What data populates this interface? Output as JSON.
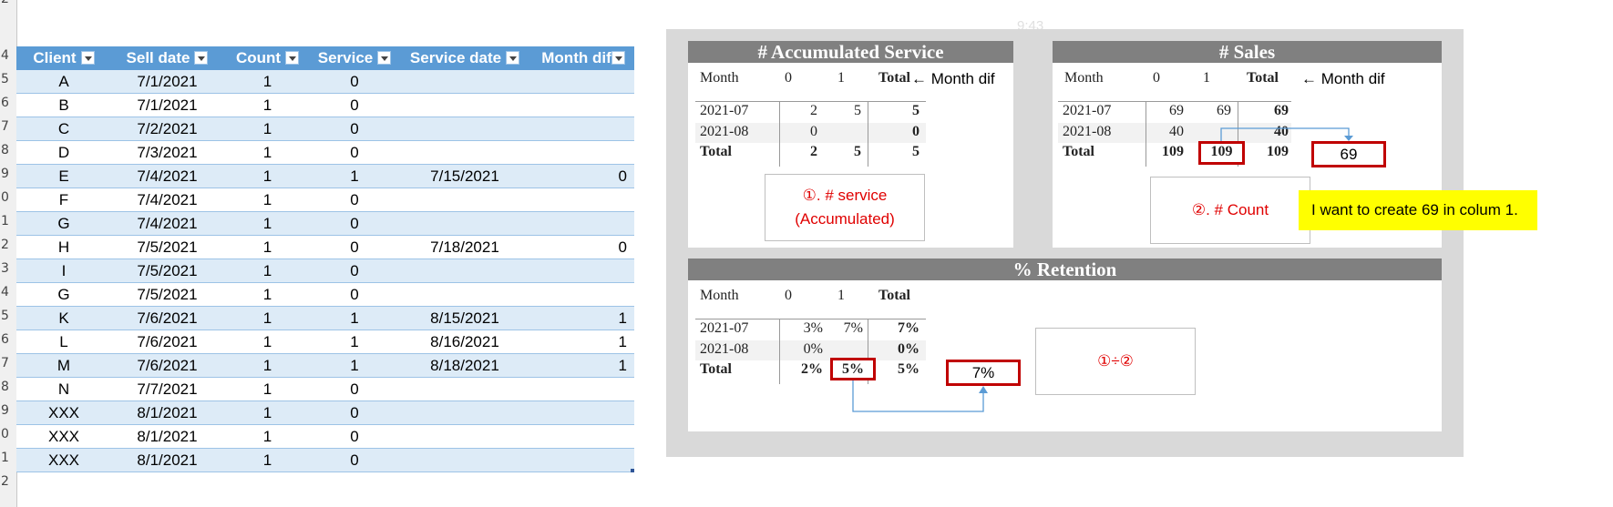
{
  "row_numbers": [
    "2",
    "4",
    "5",
    "6",
    "7",
    "8",
    "9",
    "0",
    "1",
    "2",
    "3",
    "4",
    "5",
    "6",
    "7",
    "8",
    "9",
    "0",
    "1",
    "2"
  ],
  "table": {
    "headers": [
      "Client",
      "Sell date",
      "Count",
      "Service",
      "Service date",
      "Month dif"
    ],
    "rows": [
      [
        "A",
        "7/1/2021",
        "1",
        "0",
        "",
        ""
      ],
      [
        "B",
        "7/1/2021",
        "1",
        "0",
        "",
        ""
      ],
      [
        "C",
        "7/2/2021",
        "1",
        "0",
        "",
        ""
      ],
      [
        "D",
        "7/3/2021",
        "1",
        "0",
        "",
        ""
      ],
      [
        "E",
        "7/4/2021",
        "1",
        "1",
        "7/15/2021",
        "0"
      ],
      [
        "F",
        "7/4/2021",
        "1",
        "0",
        "",
        ""
      ],
      [
        "G",
        "7/4/2021",
        "1",
        "0",
        "",
        ""
      ],
      [
        "H",
        "7/5/2021",
        "1",
        "0",
        "7/18/2021",
        "0"
      ],
      [
        "I",
        "7/5/2021",
        "1",
        "0",
        "",
        ""
      ],
      [
        "G",
        "7/5/2021",
        "1",
        "0",
        "",
        ""
      ],
      [
        "K",
        "7/6/2021",
        "1",
        "1",
        "8/15/2021",
        "1"
      ],
      [
        "L",
        "7/6/2021",
        "1",
        "1",
        "8/16/2021",
        "1"
      ],
      [
        "M",
        "7/6/2021",
        "1",
        "1",
        "8/18/2021",
        "1"
      ],
      [
        "N",
        "7/7/2021",
        "1",
        "0",
        "",
        ""
      ],
      [
        "XXX",
        "8/1/2021",
        "1",
        "0",
        "",
        ""
      ],
      [
        "XXX",
        "8/1/2021",
        "1",
        "0",
        "",
        ""
      ],
      [
        "XXX",
        "8/1/2021",
        "1",
        "0",
        "",
        ""
      ]
    ]
  },
  "faint_time": "9:43",
  "accumulated": {
    "title": "# Accumulated Service",
    "header": [
      "Month",
      "0",
      "1",
      "Total"
    ],
    "rows": [
      [
        "2021-07",
        "2",
        "5",
        "5"
      ],
      [
        "2021-08",
        "0",
        "",
        "0"
      ]
    ],
    "total": [
      "Total",
      "2",
      "5",
      "5"
    ],
    "month_dif_label": "← Month dif",
    "note_line1": "①. # service",
    "note_line2": "(Accumulated)"
  },
  "sales": {
    "title": "# Sales",
    "header": [
      "Month",
      "0",
      "1",
      "Total"
    ],
    "rows": [
      [
        "2021-07",
        "69",
        "69",
        "69"
      ],
      [
        "2021-08",
        "40",
        "",
        "40"
      ]
    ],
    "total": [
      "Total",
      "109",
      "109",
      "109"
    ],
    "month_dif_label": "← Month dif",
    "target_value": "69",
    "note": "②. # Count",
    "comment": "I want to create 69 in colum 1."
  },
  "retention": {
    "title": "% Retention",
    "header": [
      "Month",
      "0",
      "1",
      "Total"
    ],
    "rows": [
      [
        "2021-07",
        "3%",
        "7%",
        "7%"
      ],
      [
        "2021-08",
        "0%",
        "",
        "0%"
      ]
    ],
    "total": [
      "Total",
      "2%",
      "5%",
      "5%"
    ],
    "target_value": "7%",
    "note": "①÷②"
  },
  "colors": {
    "table_header": "#5b9bd5",
    "table_band": "#ddebf7",
    "panel_title": "#808080",
    "highlight_border": "#c00000",
    "note_text": "#e00000",
    "comment_bg": "#ffff00",
    "arrow": "#5b9bd5"
  }
}
